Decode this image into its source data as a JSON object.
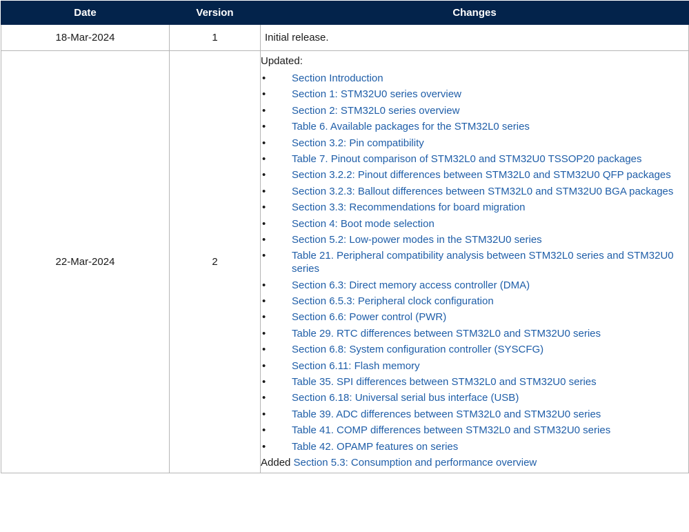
{
  "headers": {
    "date": "Date",
    "version": "Version",
    "changes": "Changes"
  },
  "colors": {
    "header_bg": "#03234b",
    "link": "#1f5ea8",
    "border": "#b5b5b5"
  },
  "rows": [
    {
      "date": "18-Mar-2024",
      "version": "1",
      "text": "Initial release."
    },
    {
      "date": "22-Mar-2024",
      "version": "2",
      "updated_label": "Updated:",
      "bullet": "•",
      "items": [
        "Section Introduction",
        "Section 1: STM32U0 series overview",
        "Section 2: STM32L0 series overview",
        "Table 6. Available packages for the STM32L0 series",
        "Section 3.2: Pin compatibility",
        "Table 7. Pinout comparison of STM32L0 and STM32U0 TSSOP20 packages",
        "Section 3.2.2: Pinout differences between STM32L0 and STM32U0 QFP packages",
        "Section 3.2.3: Ballout differences between STM32L0 and STM32U0 BGA packages",
        "Section 3.3: Recommendations for board migration",
        "Section 4: Boot mode selection",
        "Section 5.2: Low-power modes in the STM32U0 series",
        "Table 21. Peripheral compatibility analysis between STM32L0 series and STM32U0 series",
        "Section 6.3: Direct memory access controller (DMA)",
        "Section 6.5.3: Peripheral clock configuration",
        "Section 6.6: Power control (PWR)",
        "Table 29. RTC differences between STM32L0 and STM32U0 series",
        "Section 6.8: System configuration controller (SYSCFG)",
        "Section 6.11: Flash memory",
        "Table 35. SPI differences between STM32L0 and STM32U0 series",
        "Section 6.18: Universal serial bus interface (USB)",
        "Table 39. ADC differences between STM32L0 and STM32U0 series",
        "Table 41. COMP differences between STM32L0 and STM32U0 series",
        "Table 42. OPAMP features on series"
      ],
      "added_label": "Added",
      "added_link": "Section 5.3: Consumption and performance overview"
    }
  ]
}
